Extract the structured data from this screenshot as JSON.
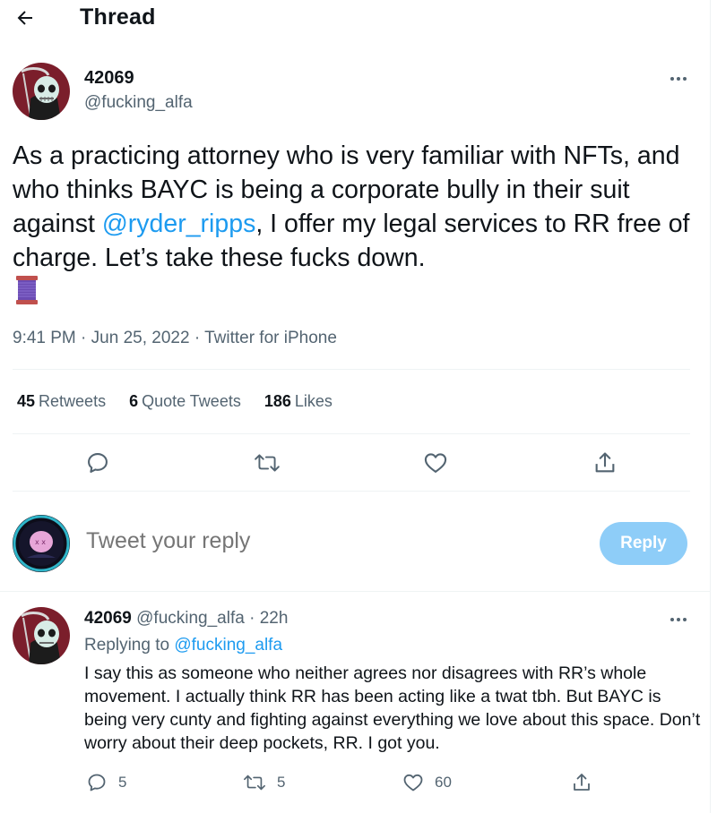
{
  "header": {
    "title": "Thread"
  },
  "tweet": {
    "author_name": "42069",
    "author_handle": "@fucking_alfa",
    "text_part1": "As a practicing attorney who is very familiar with NFTs, and who thinks BAYC is being a corporate bully in their suit against ",
    "mention": "@ryder_ripps",
    "text_part2": ", I offer  my legal services to RR free of charge.  Let’s take these fucks down.",
    "emoji": "spool-of-thread",
    "time": "9:41 PM",
    "date": "Jun 25, 2022",
    "source": "Twitter for iPhone",
    "stats": {
      "retweets_count": "45",
      "retweets_label": "Retweets",
      "quotes_count": "6",
      "quotes_label": "Quote Tweets",
      "likes_count": "186",
      "likes_label": "Likes"
    }
  },
  "composer": {
    "placeholder": "Tweet your reply",
    "button_label": "Reply"
  },
  "reply": {
    "author_name": "42069",
    "author_handle": "@fucking_alfa",
    "time_ago": "22h",
    "replying_prefix": "Replying to",
    "replying_to": "@fucking_alfa",
    "text": "I say this as someone who neither agrees nor disagrees with RR’s whole movement.  I actually think RR has been acting like a twat tbh.  But BAYC is being very cunty and fighting against everything we love about this space.  Don’t worry about their deep pockets, RR.  I got you.",
    "reply_count": "5",
    "retweet_count": "5",
    "like_count": "60"
  },
  "icons": [
    "back-arrow-icon",
    "more-icon",
    "reply-icon",
    "retweet-icon",
    "like-icon",
    "share-icon"
  ],
  "colors": {
    "accent": "#1d9bf0",
    "muted": "#536471",
    "reply_button": "#8ecdf8",
    "divider": "#eff3f4"
  }
}
